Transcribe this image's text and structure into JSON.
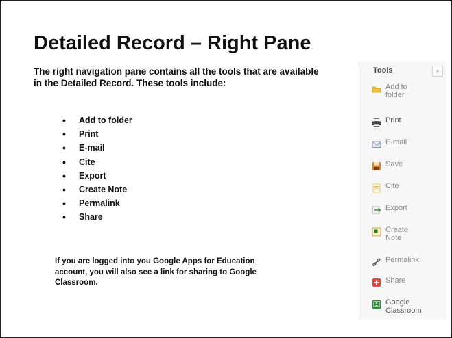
{
  "slide": {
    "title": "Detailed Record – Right Pane",
    "intro": "The right navigation pane contains all the tools that are available in the Detailed Record.  These tools include:",
    "bullets": [
      "Add to folder",
      "Print",
      "E-mail",
      "Cite",
      "Export",
      "Create Note",
      "Permalink",
      "Share"
    ],
    "outro": "If you are logged into you Google Apps for Education account, you will also see a link for sharing to Google Classroom."
  },
  "tools_panel": {
    "heading": "Tools",
    "collapse_glyph": "»",
    "items": [
      {
        "label": "Add to\nfolder",
        "icon": "folder-icon"
      },
      {
        "label": "Print",
        "icon": "printer-icon"
      },
      {
        "label": "E-mail",
        "icon": "email-icon"
      },
      {
        "label": "Save",
        "icon": "save-icon"
      },
      {
        "label": "Cite",
        "icon": "cite-icon"
      },
      {
        "label": "Export",
        "icon": "export-icon"
      },
      {
        "label": "Create\nNote",
        "icon": "note-icon"
      },
      {
        "label": "Permalink",
        "icon": "link-icon"
      },
      {
        "label": "Share",
        "icon": "share-icon"
      },
      {
        "label": "Google\nClassroom",
        "icon": "google-classroom-icon"
      }
    ]
  },
  "colors": {
    "folder": "#f0c23a",
    "save": "#d9822b",
    "share": "#e04a3c",
    "classroom": "#2e8b3a",
    "note": "#e8c64a"
  }
}
